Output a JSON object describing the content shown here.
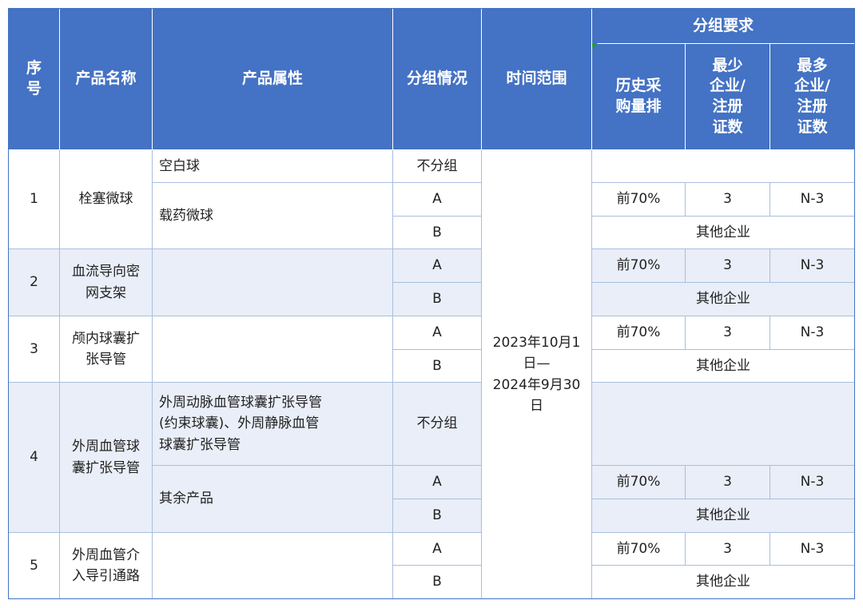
{
  "header": {
    "seq": "序\n号",
    "product_name": "产品名称",
    "product_attr": "产品属性",
    "grouping": "分组情况",
    "time_range": "时间范围",
    "group_req": "分组要求",
    "hist_rank": "历史采\n购量排",
    "min_ent": "最少\n企业/\n注册\n证数",
    "max_ent": "最多\n企业/\n注册\n证数"
  },
  "time_range_value": "2023年10月1\n日—\n2024年9月30\n日",
  "rows": [
    {
      "seq": "1",
      "name": "栓塞微球",
      "attrs": [
        "空白球",
        "载药微球"
      ],
      "groups": [
        "不分组",
        "A",
        "B"
      ],
      "rank": "前70%",
      "min": "3",
      "max": "N-3",
      "other": "其他企业"
    },
    {
      "seq": "2",
      "name": "血流导向密\n网支架",
      "groups": [
        "A",
        "B"
      ],
      "rank": "前70%",
      "min": "3",
      "max": "N-3",
      "other": "其他企业"
    },
    {
      "seq": "3",
      "name": "颅内球囊扩\n张导管",
      "groups": [
        "A",
        "B"
      ],
      "rank": "前70%",
      "min": "3",
      "max": "N-3",
      "other": "其他企业"
    },
    {
      "seq": "4",
      "name": "外周血管球\n囊扩张导管",
      "attrs": [
        "外周动脉血管球囊扩张导管\n(约束球囊)、外周静脉血管\n球囊扩张导管",
        "其余产品"
      ],
      "groups": [
        "不分组",
        "A",
        "B"
      ],
      "rank": "前70%",
      "min": "3",
      "max": "N-3",
      "other": "其他企业"
    },
    {
      "seq": "5",
      "name": "外周血管介\n入导引通路",
      "groups": [
        "A",
        "B"
      ],
      "rank": "前70%",
      "min": "3",
      "max": "N-3",
      "other": "其他企业"
    }
  ]
}
